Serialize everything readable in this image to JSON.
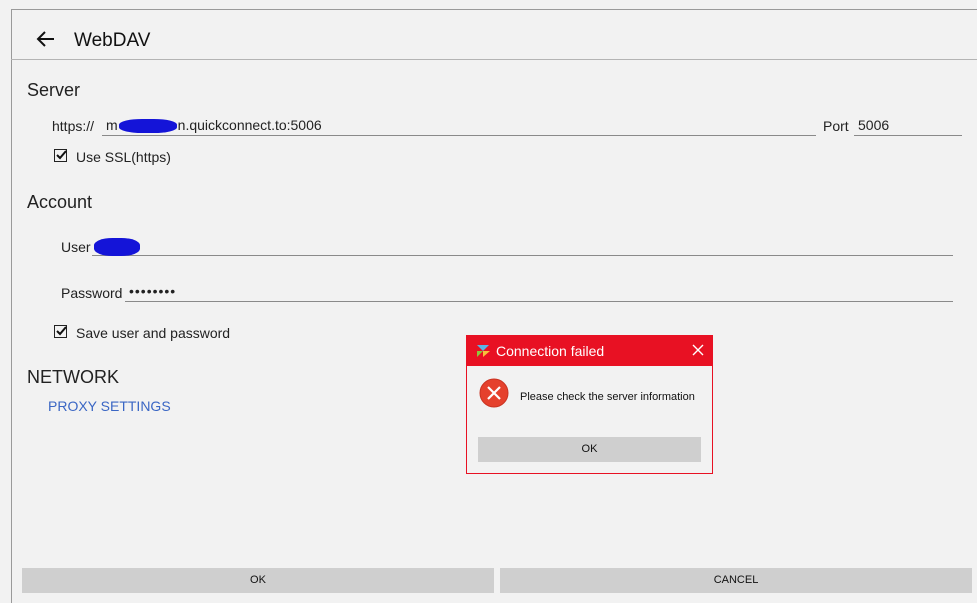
{
  "header": {
    "title": "WebDAV",
    "back_icon": "arrow-left-icon"
  },
  "server": {
    "heading": "Server",
    "protocol": "https://",
    "url_prefix": "m",
    "url_value": "n.quickconnect.to:5006",
    "port_label": "Port",
    "port_value": "5006",
    "ssl_label": "Use SSL(https)",
    "ssl_checked": true
  },
  "account": {
    "heading": "Account",
    "user_label": "User",
    "user_value": "",
    "password_label": "Password",
    "password_value": "••••••••",
    "save_label": "Save user and password",
    "save_checked": true
  },
  "network": {
    "heading": "NETWORK",
    "proxy_link": "PROXY SETTINGS"
  },
  "footer": {
    "ok_label": "OK",
    "cancel_label": "CANCEL"
  },
  "dialog": {
    "title": "Connection failed",
    "message": "Please check the server information",
    "ok_label": "OK",
    "app_icon": "app-logo-icon",
    "error_icon": "error-x-icon",
    "close_icon": "close-icon",
    "colors": {
      "title_bar": "#e81123",
      "error": "#e5412d"
    }
  }
}
